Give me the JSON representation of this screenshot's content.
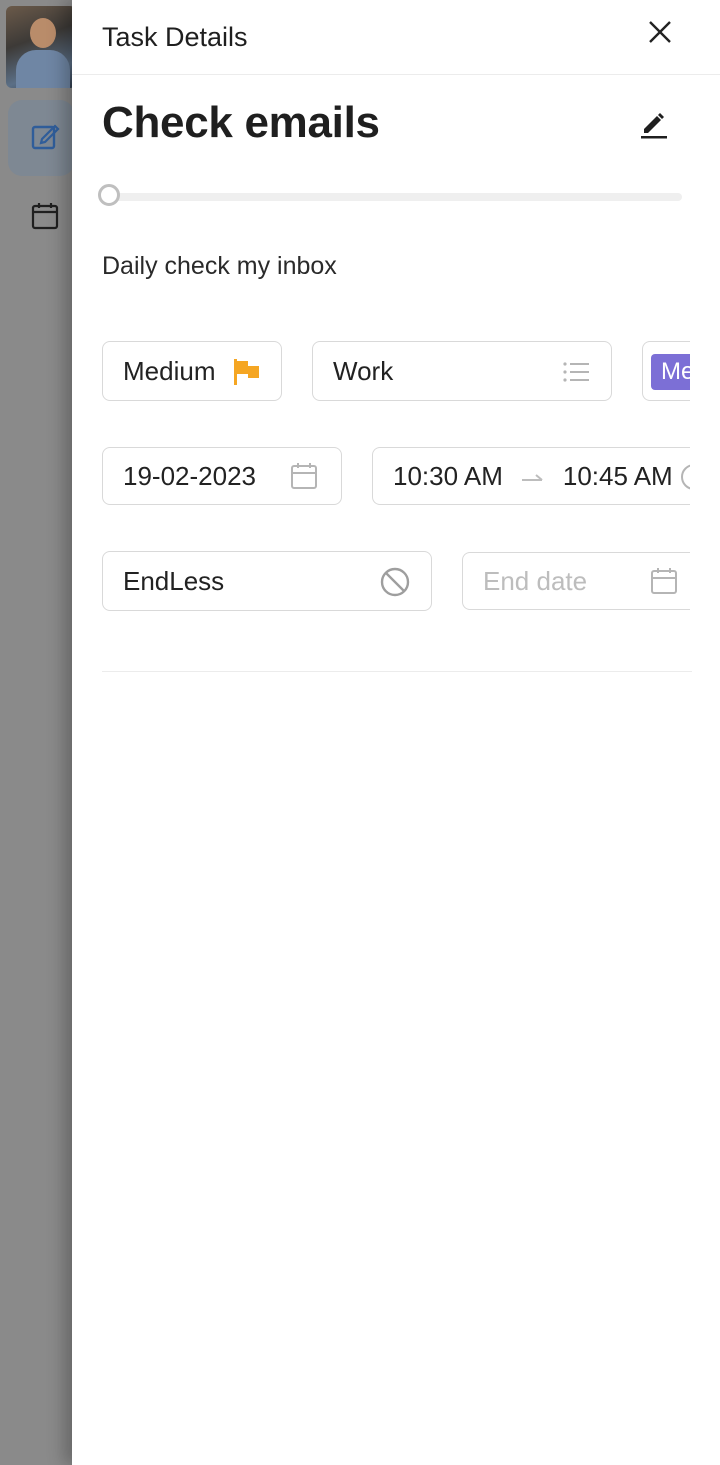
{
  "header": {
    "title": "Task Details"
  },
  "task": {
    "title": "Check emails",
    "description": "Daily check my inbox",
    "progress": 0
  },
  "priority": {
    "label": "Medium",
    "color": "#f5a623"
  },
  "list": {
    "label": "Work"
  },
  "tag": {
    "label": "Me",
    "color": "#7c6fd6"
  },
  "schedule": {
    "date": "19-02-2023",
    "start_time": "10:30 AM",
    "end_time": "10:45 AM"
  },
  "repeat": {
    "label": "EndLess",
    "end_date_placeholder": "End date"
  },
  "icons": {
    "close": "close-icon",
    "edit": "pencil-icon",
    "priority": "flag-icon",
    "list": "list-icon",
    "date": "calendar-icon",
    "repeat": "no-icon",
    "end_date": "calendar-icon"
  }
}
